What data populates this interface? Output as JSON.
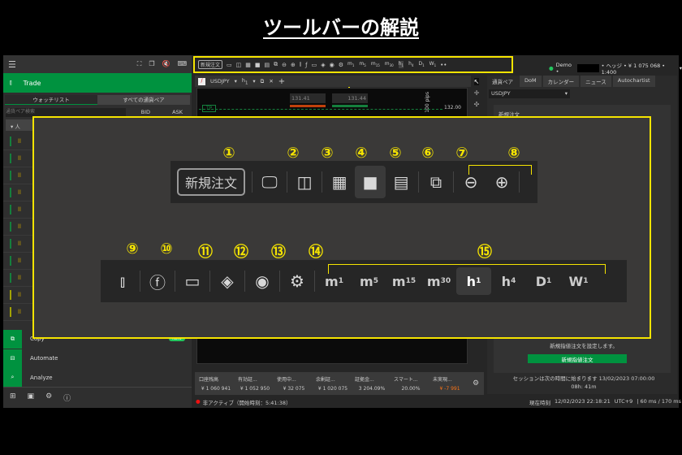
{
  "title": "ツールバーの解説",
  "left": {
    "trade": "Trade",
    "tabs": [
      "ウォッチリスト",
      "すべての通貨ペア"
    ],
    "search_placeholder": "通貨ペア検索",
    "bid": "BID",
    "ask": "ASK",
    "group": "人",
    "menu": [
      {
        "label": "Copy",
        "badge": "NEW"
      },
      {
        "label": "Automate"
      },
      {
        "label": "Analyze"
      }
    ]
  },
  "toolbar": {
    "new_order": "新規注文",
    "timeframes": [
      {
        "m": "m",
        "s": "1"
      },
      {
        "m": "m",
        "s": "5"
      },
      {
        "m": "m",
        "s": "15"
      },
      {
        "m": "m",
        "s": "30"
      },
      {
        "m": "h",
        "s": "1"
      },
      {
        "m": "h",
        "s": "4"
      },
      {
        "m": "D",
        "s": "1"
      },
      {
        "m": "W",
        "s": "1"
      }
    ],
    "more": "••"
  },
  "account": {
    "mode": "Demo •",
    "info": "• ヘッジ • ¥ 1 075 068 • 1:400"
  },
  "chart": {
    "symbol": "USDJPY",
    "timeframe": "h",
    "timeframe_sub": "1",
    "sell": "131.41",
    "buy": "131.44",
    "tp": "TP",
    "price_label": "132.00",
    "pips": "100 pips",
    "add_tab": "+"
  },
  "right": {
    "tabs": [
      "通貨ペア",
      "DoM",
      "カレンダー",
      "ニュース",
      "Autochartist"
    ],
    "symbol": "USDJPY",
    "section": "新規注文",
    "desc": "新規指値注文を設定します。",
    "button": "新規指値注文",
    "session": "セッションは次の時間に始まります 13/02/2023 07:00:00",
    "countdown": "08h: 41m"
  },
  "stats": [
    {
      "label": "口座残高",
      "value": "¥ 1 060 941"
    },
    {
      "label": "有効証...",
      "value": "¥ 1 052 950"
    },
    {
      "label": "使用中...",
      "value": "¥ 32 075"
    },
    {
      "label": "余剰証...",
      "value": "¥ 1 020 075"
    },
    {
      "label": "証拠金...",
      "value": "3 204.09%"
    },
    {
      "label": "スマート...",
      "value": "20.00%"
    },
    {
      "label": "未実現...",
      "value": "¥ -7 991"
    }
  ],
  "status": {
    "inactive": "非アクティブ（開始時刻：5:41:38）",
    "time_label": "現在時刻",
    "time": "12/02/2023 22:18:21",
    "tz": "UTC+9",
    "latency": "| 60 ms / 170 ms"
  },
  "overlay": {
    "numbers": [
      "①",
      "②",
      "③",
      "④",
      "⑤",
      "⑥",
      "⑦",
      "⑧",
      "⑨",
      "⑩",
      "⑪",
      "⑫",
      "⑬",
      "⑭",
      "⑮"
    ]
  },
  "colors": {
    "highlight": "#f5e400",
    "brand_green": "#00923f",
    "sell": "#c2410c",
    "buy": "#15803d",
    "negative": "#f97316"
  }
}
